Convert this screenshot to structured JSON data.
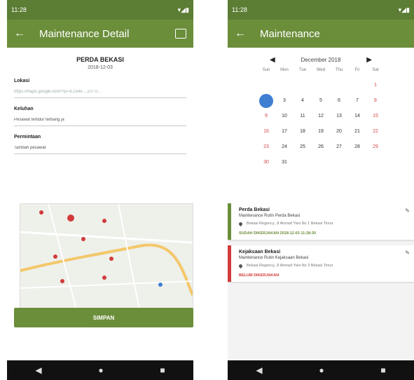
{
  "left": {
    "status": {
      "time": "11:28",
      "right": "▾◢▮"
    },
    "appbar": {
      "title": "Maintenance Detail"
    },
    "detail": {
      "name": "PERDA BEKASI",
      "date": "2018-12-03"
    },
    "fields": [
      {
        "label": "Lokasi",
        "value": "https://maps.google.com/?q=-6.2349...,107.0..."
      },
      {
        "label": "Keluhan",
        "value": "Pesawat tertidur terbang ja"
      },
      {
        "label": "Permintaan",
        "value": "Tambah pesawat"
      }
    ],
    "save_label": "SIMPAN"
  },
  "right": {
    "status": {
      "time": "11:28",
      "right": "▾◢▮"
    },
    "appbar": {
      "title": "Maintenance"
    },
    "calendar": {
      "month": "December 2018",
      "dow": [
        "Sun",
        "Mon",
        "Tue",
        "Wed",
        "Thu",
        "Fri",
        "Sat"
      ],
      "weeks": [
        [
          "",
          "",
          "",
          "",
          "",
          "",
          "1"
        ],
        [
          "2",
          "3",
          "4",
          "5",
          "6",
          "7",
          "8"
        ],
        [
          "9",
          "10",
          "11",
          "12",
          "13",
          "14",
          "15"
        ],
        [
          "16",
          "17",
          "18",
          "19",
          "20",
          "21",
          "22"
        ],
        [
          "23",
          "24",
          "25",
          "26",
          "27",
          "28",
          "29"
        ],
        [
          "30",
          "31",
          "",
          "",
          "",
          "",
          ""
        ]
      ]
    },
    "cards": [
      {
        "title": "Perda Bekasi",
        "subtitle": "Maintenance Rutin Perda Bekasi",
        "location": "Bekasi Regency, Jl Ahmad Yani No 1 Bekasi Timur",
        "status": "SUDAH DIKERJAKAN  2018-12-03 11:28:30",
        "color": "#6b8e3a"
      },
      {
        "title": "Kejaksaan Bekasi",
        "subtitle": "Maintenance Rutin Kejaksaan Bekasi",
        "location": "Bekasi Regency, Jl Ahmad Yani No 3 Bekasi Timur",
        "status": "BELUM DIKERJAKAN",
        "color": "#d23a3a"
      }
    ]
  },
  "colors": {
    "primary": "#6b8e3a",
    "dark": "#5b7d34",
    "danger": "#d23a3a",
    "selected": "#3f7fd2"
  }
}
